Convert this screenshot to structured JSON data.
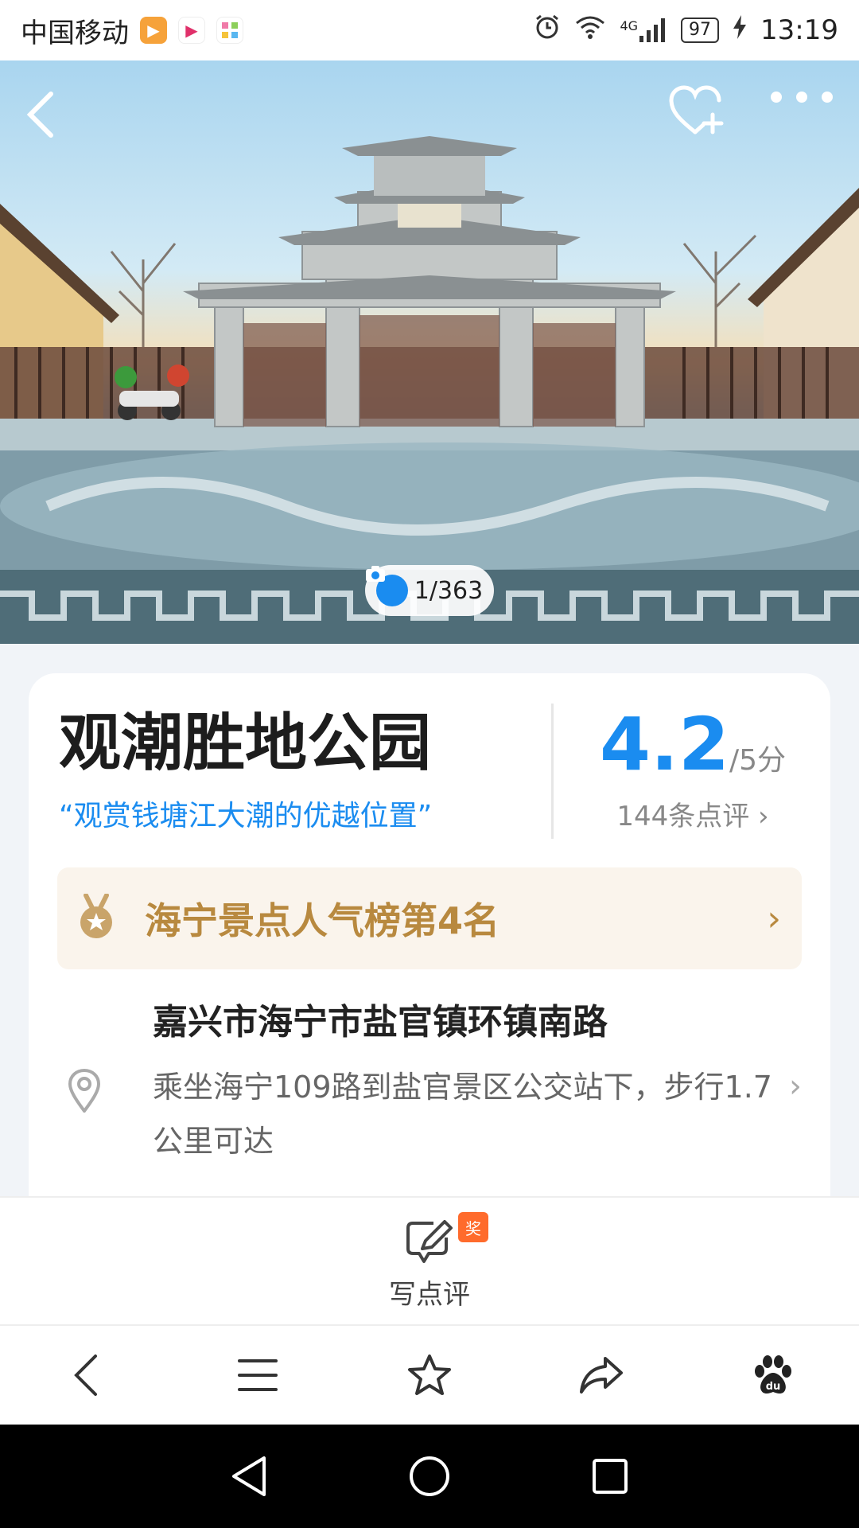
{
  "status_bar": {
    "carrier": "中国移动",
    "network": "4G",
    "battery": "97",
    "time": "13:19"
  },
  "hero": {
    "photo_counter": "1/363"
  },
  "poi": {
    "title": "观潮胜地公园",
    "slogan": "“观赏钱塘江大潮的优越位置”",
    "rating": "4.2",
    "rating_unit": "/5分",
    "review_count": "144条点评",
    "rank": "海宁景点人气榜第4名",
    "address": "嘉兴市海宁市盐官镇环镇南路",
    "directions": "乘坐海宁109路到盐官景区公交站下，步行1.7公里可达"
  },
  "write_review": {
    "label": "写点评",
    "badge": "奖"
  },
  "colors": {
    "accent": "#1a8cf0",
    "rank_gold": "#b8893f",
    "badge_orange": "#ff6b2c"
  },
  "icons": {
    "back": "back-arrow-icon",
    "favorite": "heart-plus-icon",
    "more": "more-dots-icon",
    "camera": "camera-icon",
    "medal": "medal-icon",
    "pin": "location-pin-icon",
    "edit": "edit-note-icon",
    "menu": "menu-icon",
    "star": "star-icon",
    "share": "share-icon",
    "baidu": "baidu-paw-icon"
  }
}
